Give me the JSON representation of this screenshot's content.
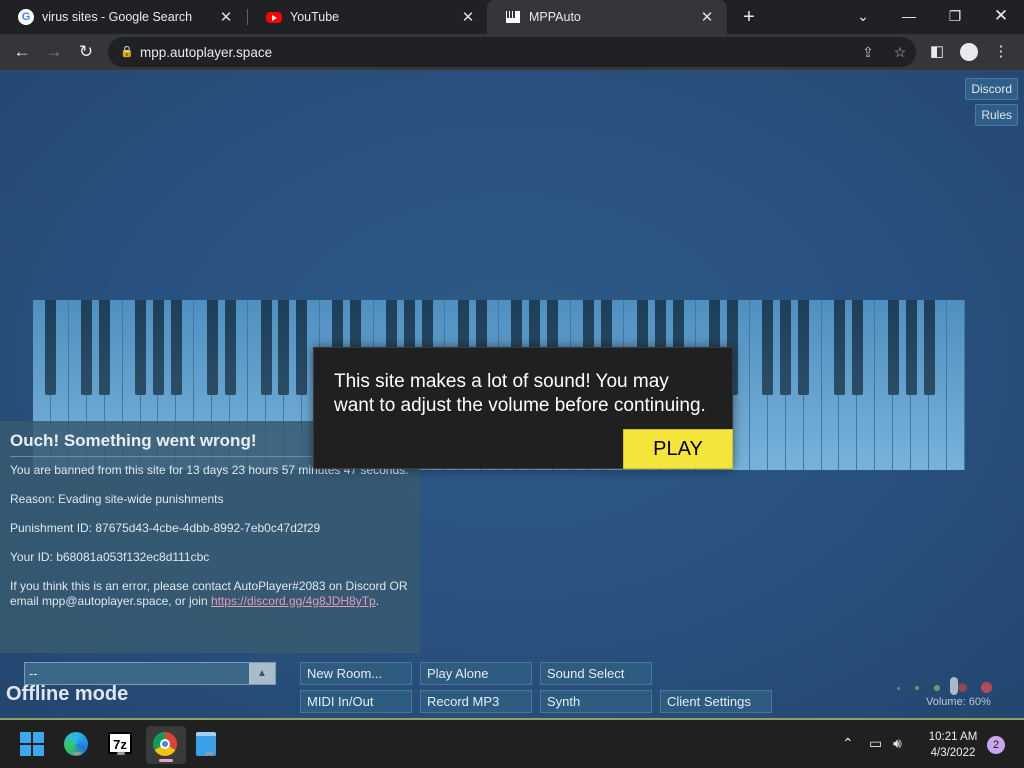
{
  "browser": {
    "tabs": [
      {
        "title": "virus sites - Google Search",
        "favicon": "google-g-icon",
        "active": false
      },
      {
        "title": "YouTube",
        "favicon": "youtube-icon",
        "active": false
      },
      {
        "title": "MPPAuto",
        "favicon": "piano-icon",
        "active": true
      }
    ],
    "url": "mpp.autoplayer.space"
  },
  "page": {
    "top_links": {
      "discord": "Discord",
      "rules": "Rules"
    },
    "sound_modal": {
      "message": "This site makes a lot of sound! You may want to adjust the volume before continuing.",
      "play_label": "PLAY"
    },
    "ban_notice": {
      "title": "Ouch! Something went wrong!",
      "duration": "You are banned from this site for 13 days 23 hours 57 minutes 47 seconds.",
      "reason": "Reason: Evading site-wide punishments",
      "punishment_id": "Punishment ID: 87675d43-4cbe-4dbb-8992-7eb0c47d2f29",
      "your_id": "Your ID: b68081a053f132ec8d111cbc",
      "contact": "If you think this is an error, please contact AutoPlayer#2083 on Discord OR email mpp@autoplayer.space, or join ",
      "link": "https://discord.gg/4g8JDH8yTp",
      "link_suffix": "."
    },
    "room_select_value": "--",
    "offline_label": "Offline mode",
    "buttons": {
      "new_room": "New Room...",
      "play_alone": "Play Alone",
      "sound_select": "Sound Select",
      "midi": "MIDI In/Out",
      "record_mp3": "Record MP3",
      "synth": "Synth",
      "client_settings": "Client Settings"
    },
    "volume_label": "Volume: 60%",
    "volume_level": 0.6
  },
  "taskbar": {
    "time": "10:21 AM",
    "date": "4/3/2022",
    "notification_count": "2"
  }
}
